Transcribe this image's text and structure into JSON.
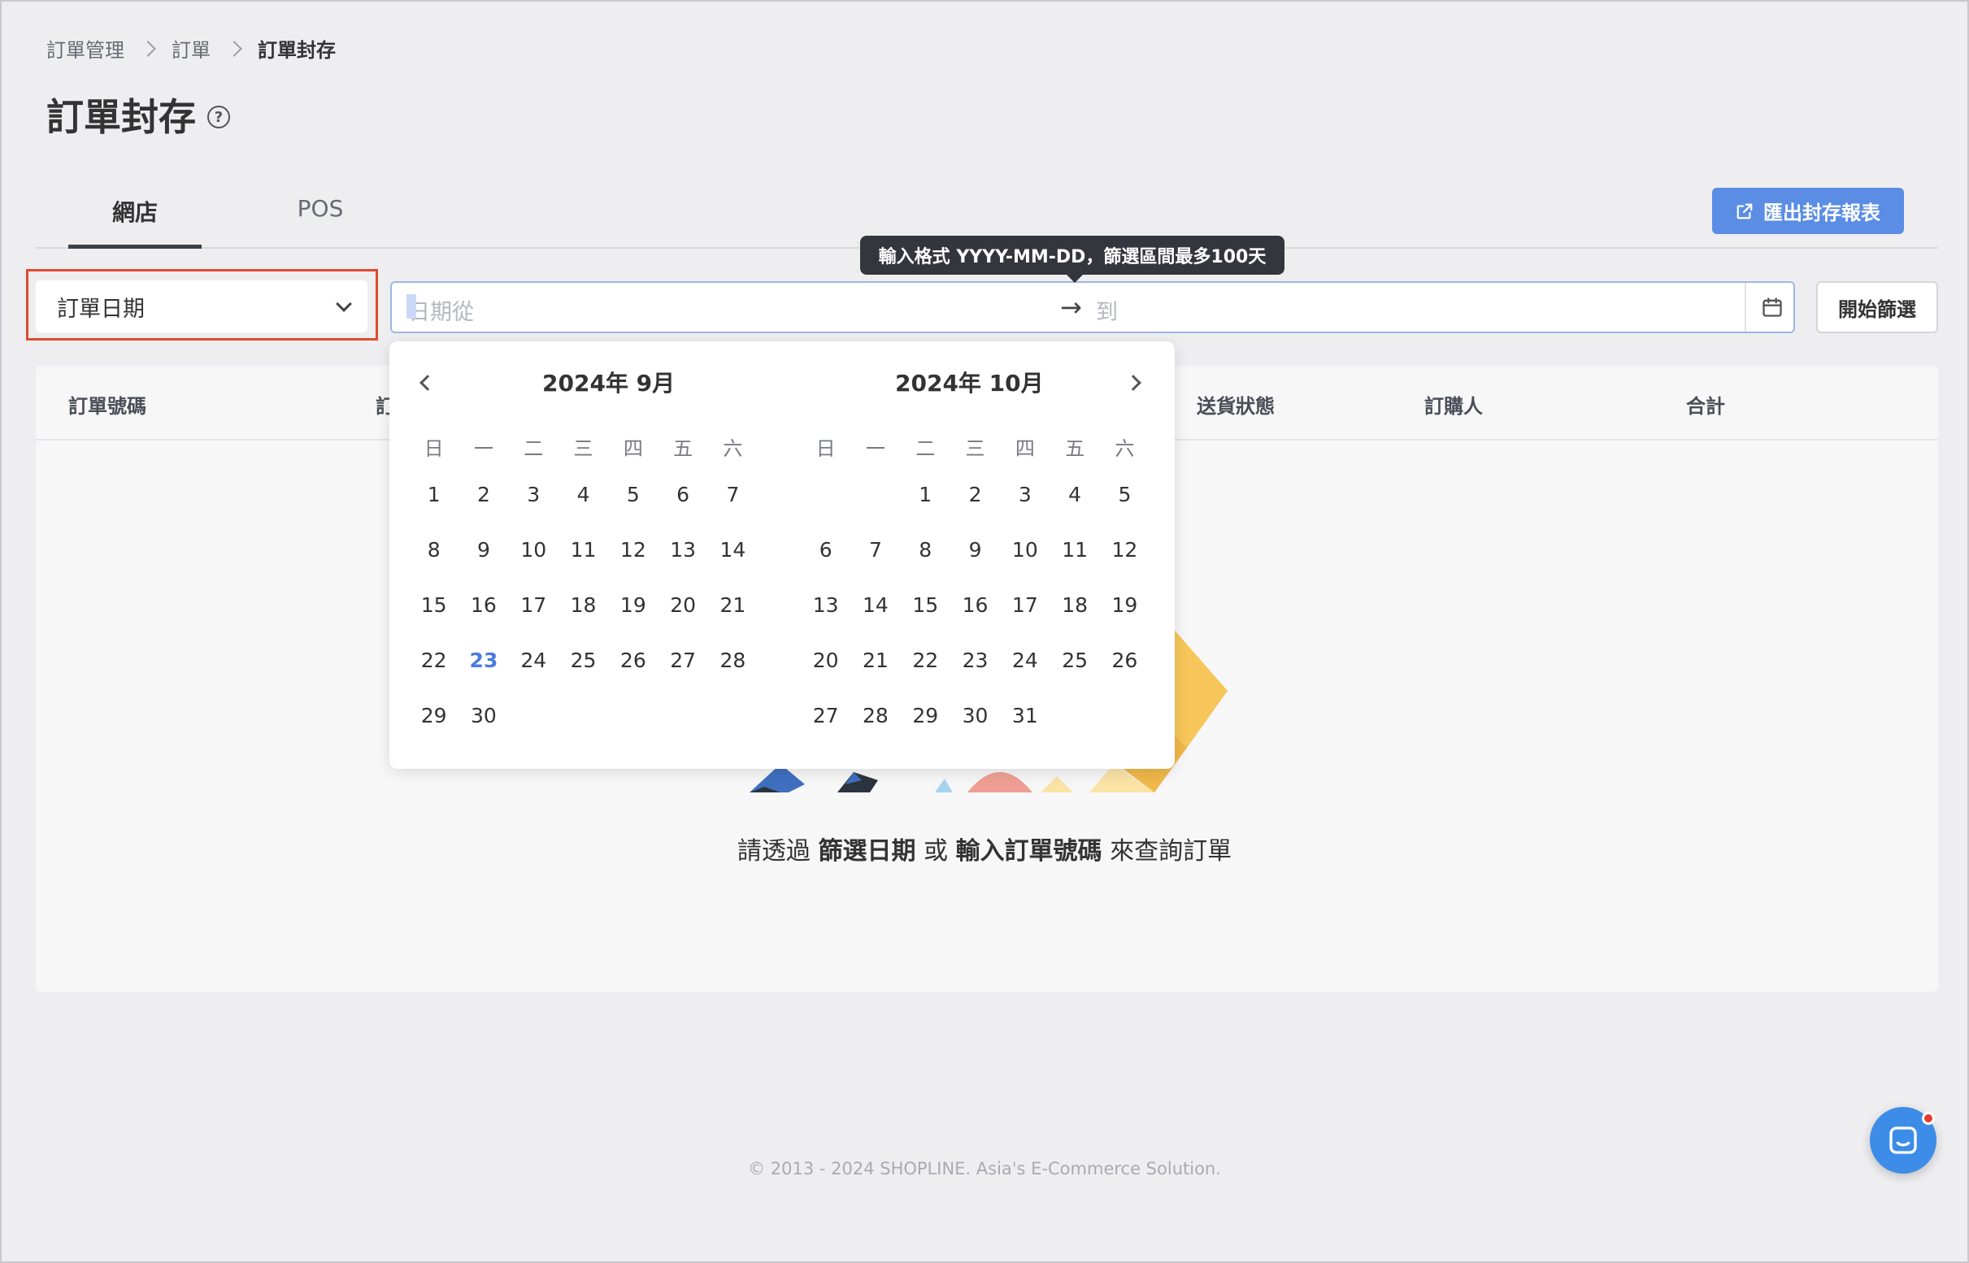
{
  "breadcrumb": [
    "訂單管理",
    "訂單",
    "訂單封存"
  ],
  "page": {
    "title": "訂單封存"
  },
  "tabs": [
    {
      "label": "網店",
      "active": true
    },
    {
      "label": "POS",
      "active": false
    }
  ],
  "toolbar": {
    "export_label": "匯出封存報表"
  },
  "filter": {
    "date_type": "訂單日期",
    "date_from_placeholder": "日期從",
    "date_to_placeholder": "到",
    "start_label": "開始篩選",
    "tooltip": "輸入格式 YYYY-MM-DD，篩選區間最多100天"
  },
  "table": {
    "headers": [
      "訂單號碼",
      "訂",
      "送貨狀態",
      "訂購人",
      "合計"
    ]
  },
  "empty": {
    "prefix": "請透過",
    "bold1": "篩選日期",
    "middle": "或",
    "bold2": "輸入訂單號碼",
    "suffix": "來查詢訂單"
  },
  "calendar": {
    "weekdays": [
      "日",
      "一",
      "二",
      "三",
      "四",
      "五",
      "六"
    ],
    "months": [
      {
        "title": "2024年 9月",
        "offset": 0,
        "days": 30,
        "today": 23
      },
      {
        "title": "2024年 10月",
        "offset": 2,
        "days": 31,
        "today": null
      }
    ]
  },
  "footer": "© 2013 - 2024 SHOPLINE. Asia's E-Commerce Solution.",
  "colors": {
    "accent": "#5b8de4",
    "highlight": "#e04a30",
    "today": "#4a7be0"
  }
}
